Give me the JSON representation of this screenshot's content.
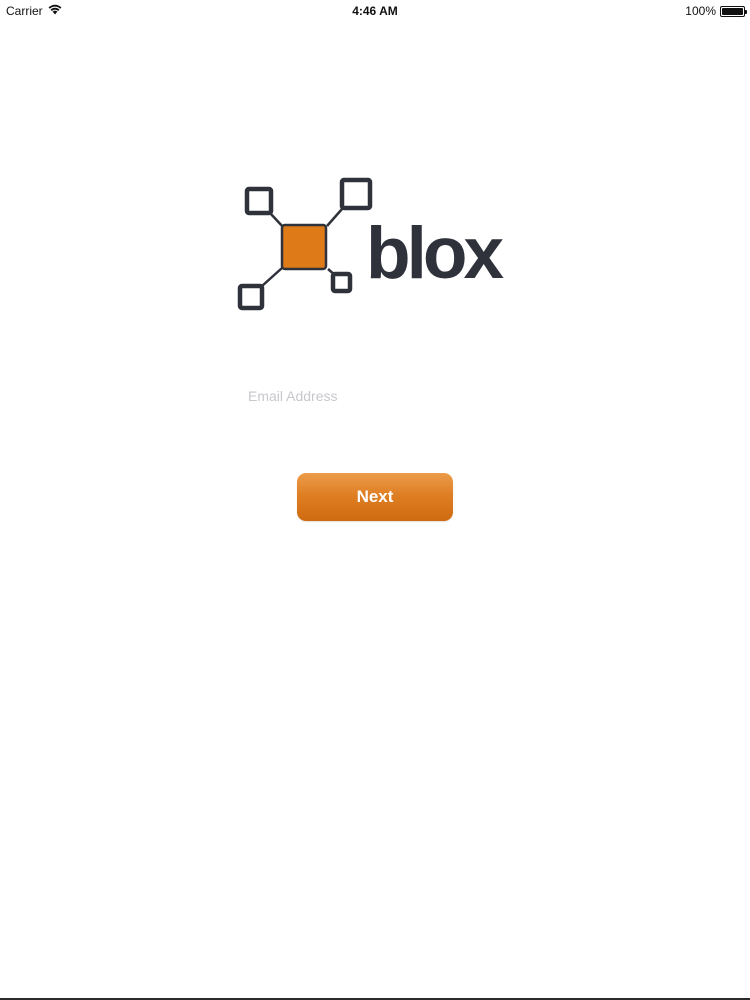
{
  "status_bar": {
    "carrier": "Carrier",
    "time": "4:46 AM",
    "battery_percent": "100%",
    "battery_level": 1.0,
    "wifi_icon": "wifi-icon",
    "battery_icon": "battery-icon"
  },
  "logo": {
    "wordmark": "blox",
    "colors": {
      "dark": "#2f323b",
      "accent": "#df7a18"
    }
  },
  "login": {
    "email_placeholder": "Email Address",
    "email_value": "",
    "next_label": "Next"
  },
  "theme": {
    "accent": "#df7f24",
    "background": "#ffffff"
  }
}
